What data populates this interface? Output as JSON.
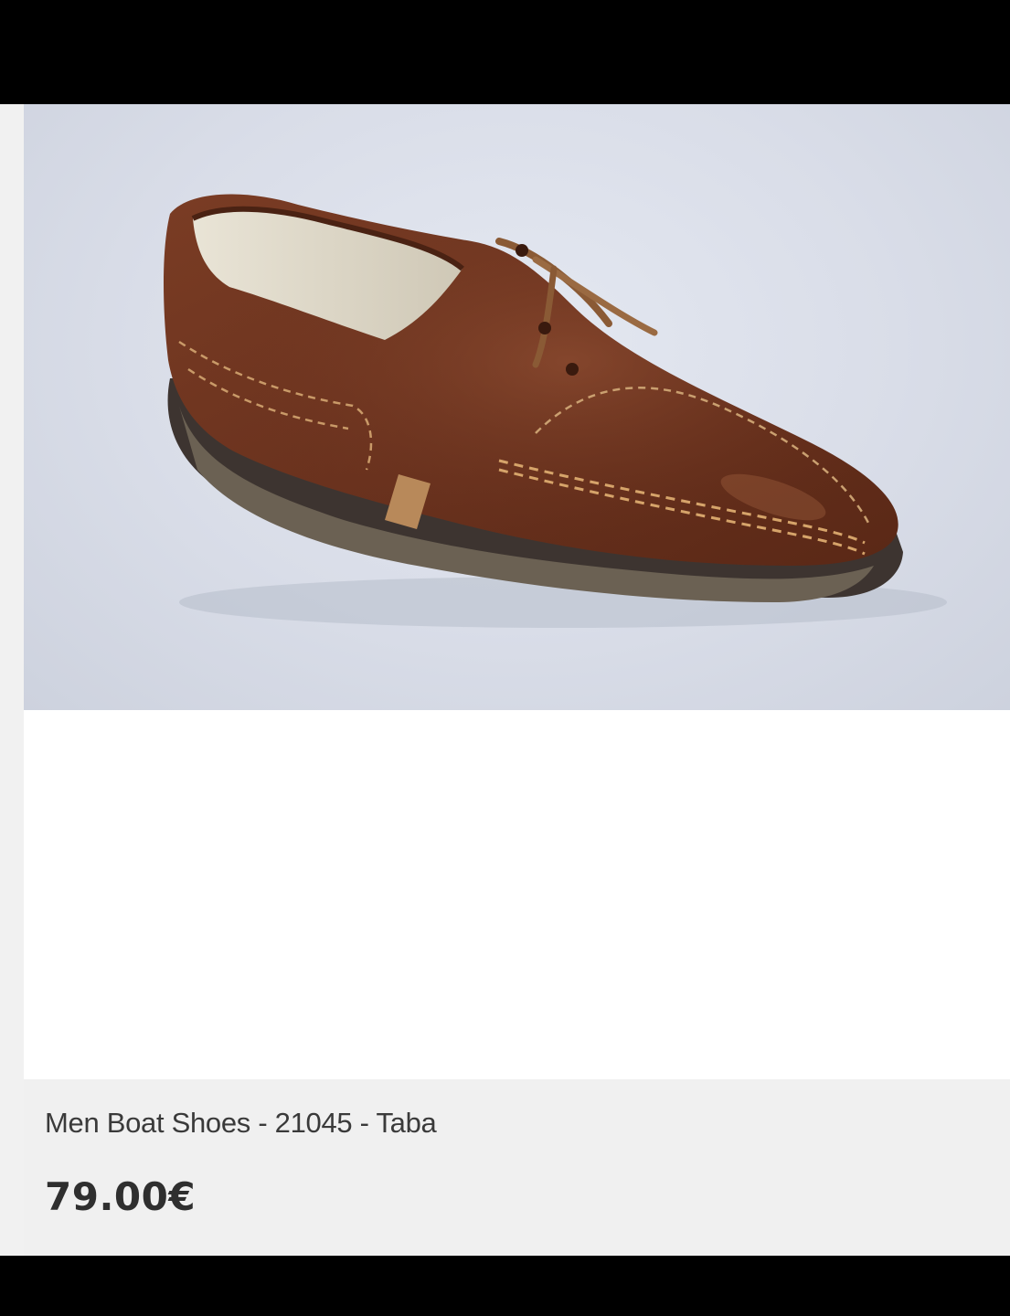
{
  "product": {
    "image_icon": "boat-shoe-photo",
    "title": "Men Boat Shoes - 21045 - Taba",
    "price": "79.00€"
  },
  "colors": {
    "background": "#f1f1f1",
    "card": "#ffffff",
    "info_panel": "#f0f0f0",
    "title_text": "#3a3a3a",
    "price_text": "#2f2f2f",
    "shoe_leather": "#6e3520"
  }
}
